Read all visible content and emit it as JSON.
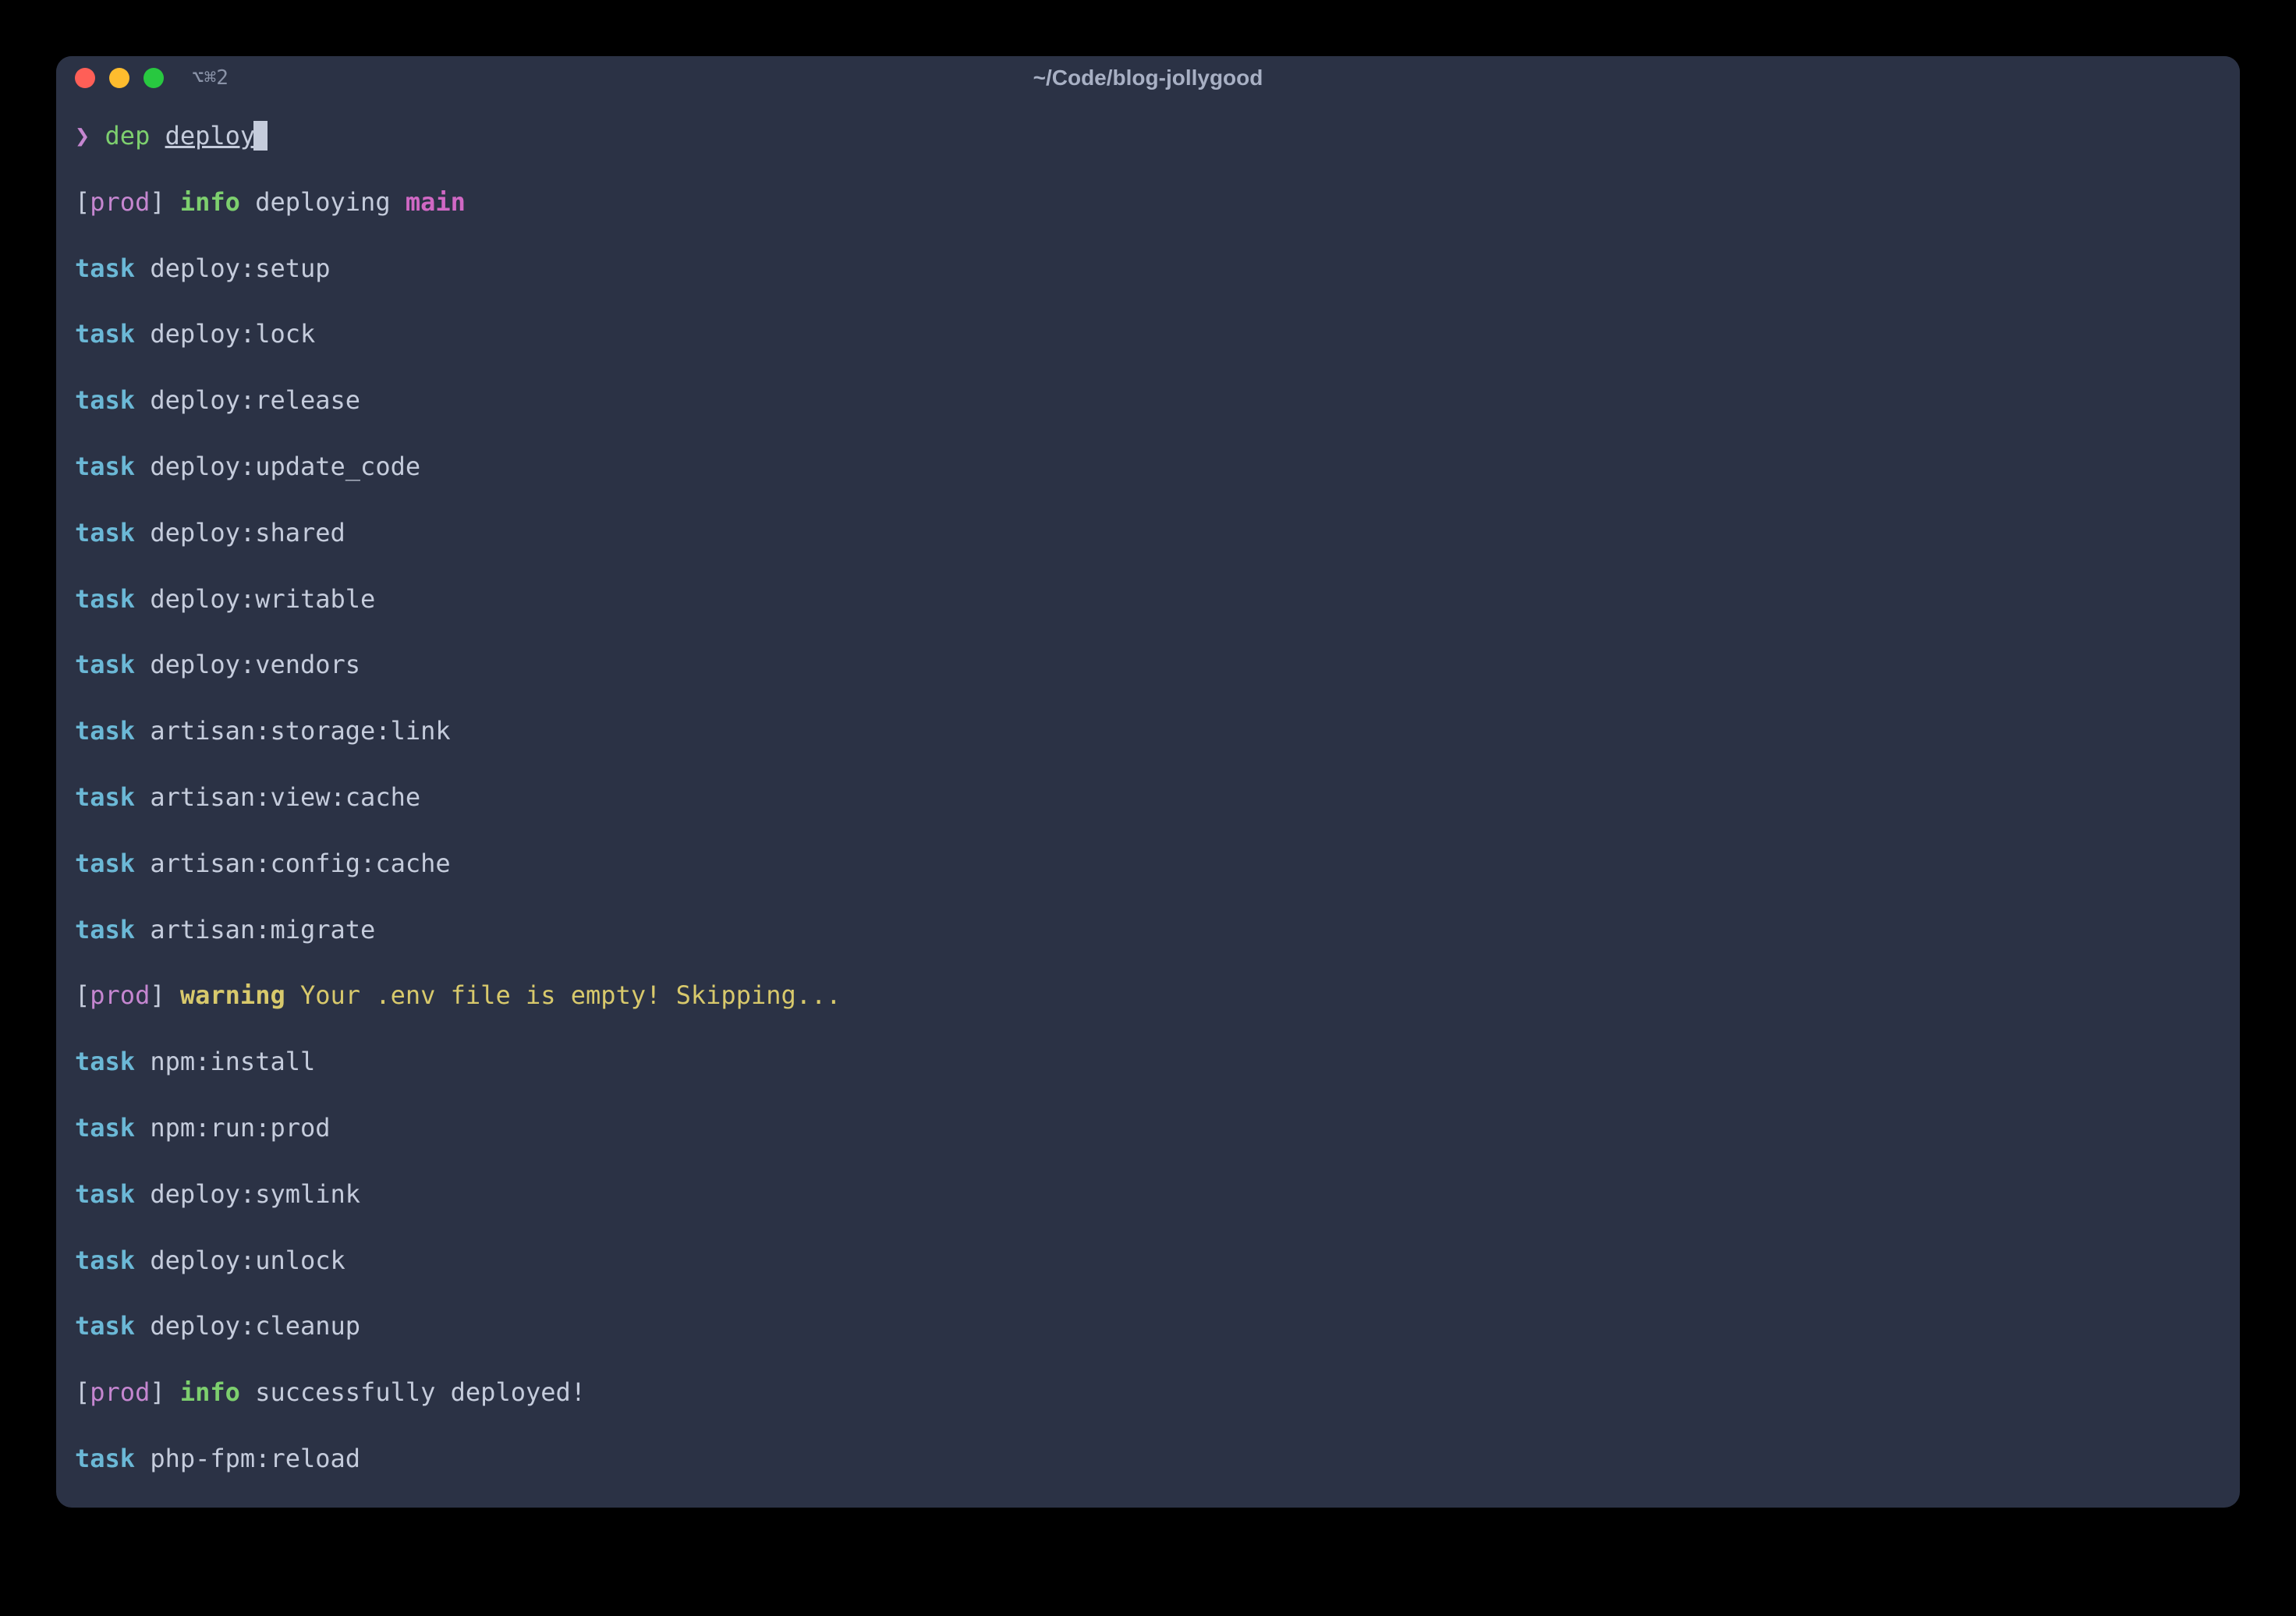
{
  "window": {
    "title": "~/Code/blog-jollygood",
    "tab_indicator": "⌥⌘2"
  },
  "prompt": {
    "caret": "❯",
    "command": "dep",
    "arg": "deploy"
  },
  "lines": [
    {
      "type": "info",
      "host": "prod",
      "label": "info",
      "text": "deploying",
      "branch": "main"
    },
    {
      "type": "task",
      "label": "task",
      "name": "deploy:setup"
    },
    {
      "type": "task",
      "label": "task",
      "name": "deploy:lock"
    },
    {
      "type": "task",
      "label": "task",
      "name": "deploy:release"
    },
    {
      "type": "task",
      "label": "task",
      "name": "deploy:update_code"
    },
    {
      "type": "task",
      "label": "task",
      "name": "deploy:shared"
    },
    {
      "type": "task",
      "label": "task",
      "name": "deploy:writable"
    },
    {
      "type": "task",
      "label": "task",
      "name": "deploy:vendors"
    },
    {
      "type": "task",
      "label": "task",
      "name": "artisan:storage:link"
    },
    {
      "type": "task",
      "label": "task",
      "name": "artisan:view:cache"
    },
    {
      "type": "task",
      "label": "task",
      "name": "artisan:config:cache"
    },
    {
      "type": "task",
      "label": "task",
      "name": "artisan:migrate"
    },
    {
      "type": "warning",
      "host": "prod",
      "label": "warning",
      "text": "Your .env file is empty! Skipping..."
    },
    {
      "type": "task",
      "label": "task",
      "name": "npm:install"
    },
    {
      "type": "task",
      "label": "task",
      "name": "npm:run:prod"
    },
    {
      "type": "task",
      "label": "task",
      "name": "deploy:symlink"
    },
    {
      "type": "task",
      "label": "task",
      "name": "deploy:unlock"
    },
    {
      "type": "task",
      "label": "task",
      "name": "deploy:cleanup"
    },
    {
      "type": "info",
      "host": "prod",
      "label": "info",
      "text": "successfully deployed!"
    },
    {
      "type": "task",
      "label": "task",
      "name": "php-fpm:reload"
    }
  ]
}
